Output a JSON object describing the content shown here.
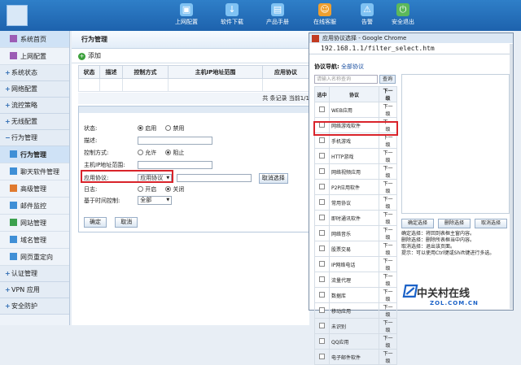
{
  "header": {
    "nav": [
      {
        "label": "上网配置",
        "icon": "monitor-icon"
      },
      {
        "label": "软件下载",
        "icon": "download-icon"
      },
      {
        "label": "产品手册",
        "icon": "manual-icon"
      },
      {
        "label": "在线客服",
        "icon": "support-icon"
      },
      {
        "label": "告警",
        "icon": "alarm-icon"
      },
      {
        "label": "安全退出",
        "icon": "logout-icon"
      }
    ]
  },
  "sidebar": {
    "top_items": [
      "系统首页",
      "上网配置"
    ],
    "sections": [
      "系统状态",
      "网络配置",
      "流控策略",
      "无线配置"
    ],
    "behavior_section": "行为管理",
    "behavior_items": [
      "行为管理",
      "聊天软件管理",
      "高级管理",
      "邮件监控",
      "网站管理",
      "域名管理",
      "网页重定向"
    ],
    "bottom_sections": [
      "认证管理",
      "VPN 应用",
      "安全防护"
    ]
  },
  "main": {
    "title": "行为管理",
    "add_label": "添加",
    "columns": [
      "状态",
      "描述",
      "控制方式",
      "主机IP地址范围",
      "应用协议"
    ],
    "footer": "共 条记录 当前1/1",
    "form": {
      "status_label": "状态:",
      "status_options": [
        "启用",
        "禁用"
      ],
      "desc_label": "描述:",
      "control_label": "控制方式:",
      "control_options": [
        "允许",
        "阻止"
      ],
      "ip_label": "主机IP地址范围:",
      "protocol_label": "应用协议:",
      "protocol_value": "应用协议",
      "cancel_select": "取消选择",
      "log_label": "日志:",
      "log_options": [
        "开启",
        "关闭"
      ],
      "time_label": "基于时间控制:",
      "time_value": "全部",
      "ok": "确定",
      "cancel": "取消"
    }
  },
  "popup": {
    "title": "应用协议选择 - Google Chrome",
    "url": "192.168.1.1/filter_select.htm",
    "nav_label": "协议导航:",
    "nav_link": "全部协议",
    "search_placeholder": "请输入名称查询",
    "query_button": "查询",
    "list_headers": [
      "选中",
      "协议",
      "下一级"
    ],
    "protocols": [
      "WEB应用",
      "网络游戏软件",
      "手机游戏",
      "HTTP游戏",
      "网络视频应用",
      "P2P应用软件",
      "常用协议",
      "即时通讯软件",
      "网络音乐",
      "股票交易",
      "IP网络电话",
      "流量代理",
      "数据库",
      "移动应用",
      "未识别",
      "QQ应用",
      "电子邮件软件"
    ],
    "next_label": "下一级",
    "buttons": [
      "确定选择",
      "删除选择",
      "取消选择"
    ],
    "tips": [
      "确定选择：将回到表框主窗内容。",
      "删除选择：删除所表框当中内容。",
      "取消选择：退出该页面。",
      "提示：可以使用Ctrl键或Shift键进行多选。"
    ]
  },
  "watermark": {
    "name": "中关村在线",
    "domain": "ZOL.COM.CN"
  }
}
